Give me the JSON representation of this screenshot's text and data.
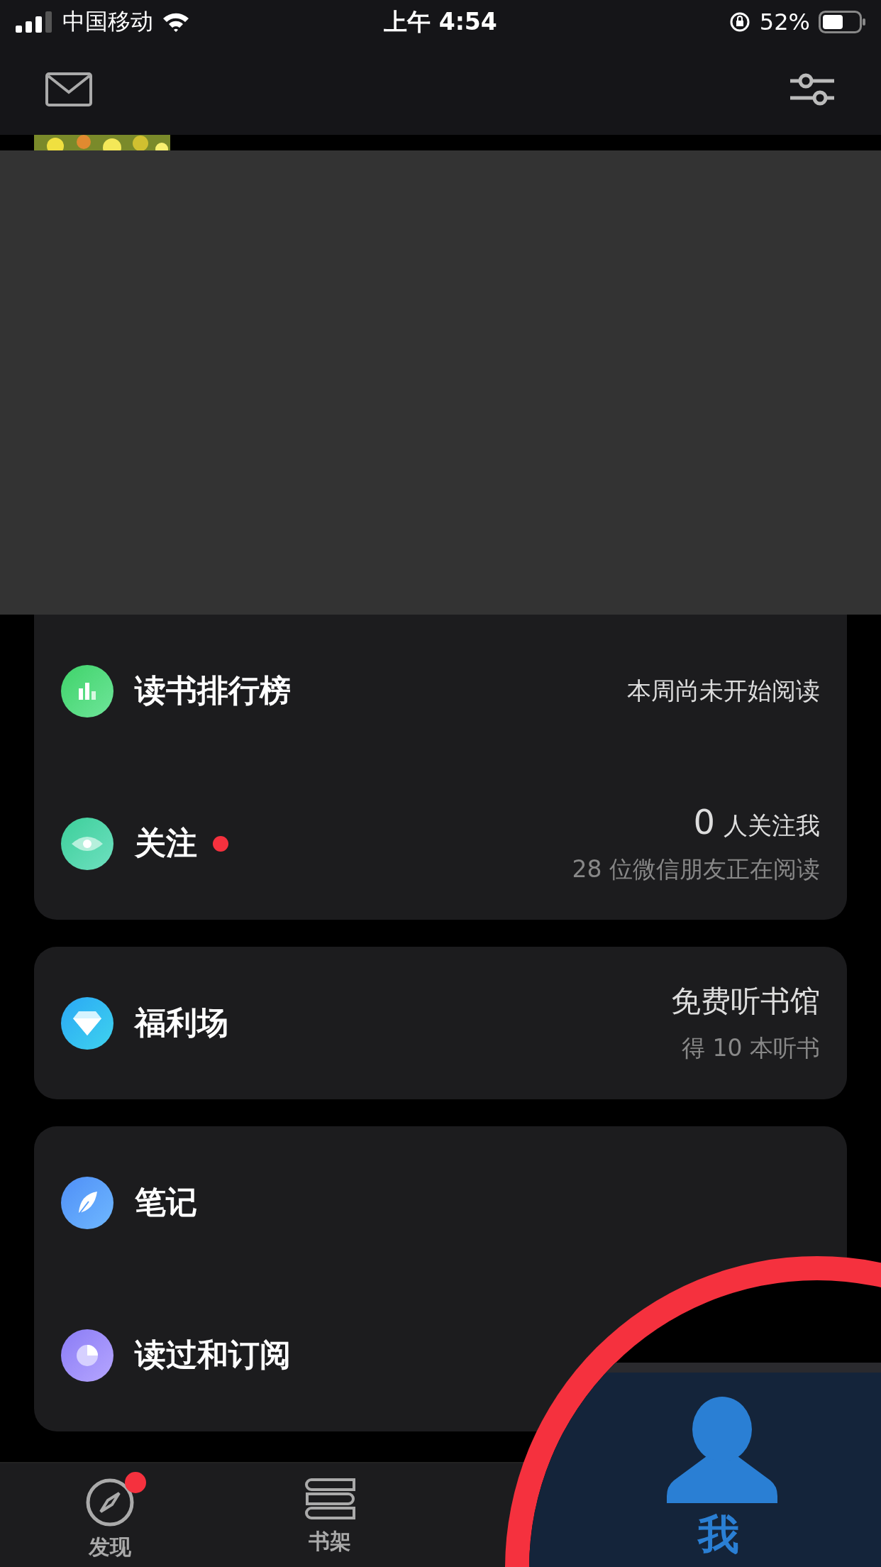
{
  "status_bar": {
    "carrier": "中国移动",
    "time": "上午 4:54",
    "battery": "52%"
  },
  "cards": [
    {
      "rows": [
        {
          "title": "读书排行榜",
          "badge": false,
          "right_lines": [
            {
              "kind": "plain",
              "text": "本周尚未开始阅读"
            }
          ]
        },
        {
          "title": "关注",
          "badge": true,
          "right_lines": [
            {
              "kind": "count",
              "number": "0",
              "text": "人关注我"
            },
            {
              "kind": "sub",
              "text": "28 位微信朋友正在阅读"
            }
          ]
        }
      ]
    },
    {
      "rows": [
        {
          "title": "福利场",
          "badge": false,
          "right_lines": [
            {
              "kind": "big",
              "text": "免费听书馆"
            },
            {
              "kind": "sub",
              "text": "得 10 本听书"
            }
          ]
        }
      ]
    },
    {
      "rows": [
        {
          "title": "笔记",
          "badge": false,
          "right_lines": []
        },
        {
          "title": "读过和订阅",
          "badge": false,
          "right_lines": []
        }
      ]
    }
  ],
  "tab_bar": {
    "tabs": [
      {
        "label": "发现",
        "selected": false,
        "badge": true
      },
      {
        "label": "书架",
        "selected": false,
        "badge": false
      }
    ]
  },
  "magnifier": {
    "label": "我",
    "selected": true
  }
}
